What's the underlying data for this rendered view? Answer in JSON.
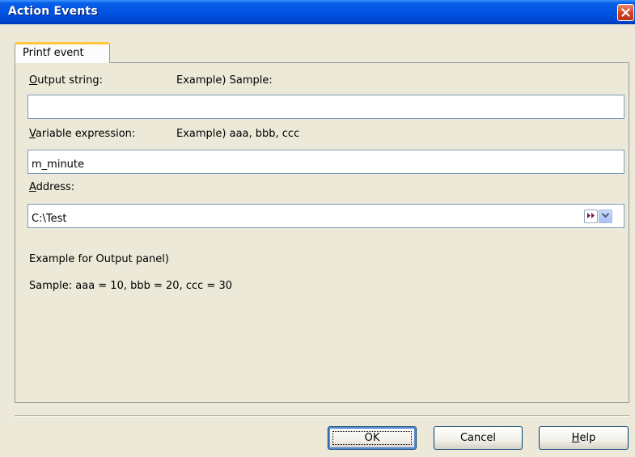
{
  "window": {
    "title": "Action Events"
  },
  "tabs": [
    {
      "label": "Printf event",
      "selected": true
    }
  ],
  "output_string": {
    "label_mnemonic": "O",
    "label_rest": "utput string:",
    "example": "Example) Sample:",
    "value": ""
  },
  "variable_expression": {
    "label_mnemonic": "V",
    "label_rest": "ariable expression:",
    "example": "Example) aaa, bbb, ccc",
    "value": "m_minute"
  },
  "address": {
    "label_mnemonic": "A",
    "label_rest": "ddress:",
    "value": "C:\\Test"
  },
  "example_panel": {
    "heading": "Example for Output panel)",
    "sample": "Sample: aaa = 10, bbb = 20, ccc = 30"
  },
  "buttons": {
    "ok": "OK",
    "cancel": "Cancel",
    "help_mnemonic": "H",
    "help_rest": "elp"
  },
  "colors": {
    "title_bar": "#0054e3",
    "dialog_bg": "#ece9d8",
    "close_button": "#d0411e",
    "tab_highlight": "#ffc83c"
  },
  "icons": {
    "close": "close-icon",
    "address_options": "fast-forward-icon",
    "address_dropdown": "chevron-down-icon"
  }
}
